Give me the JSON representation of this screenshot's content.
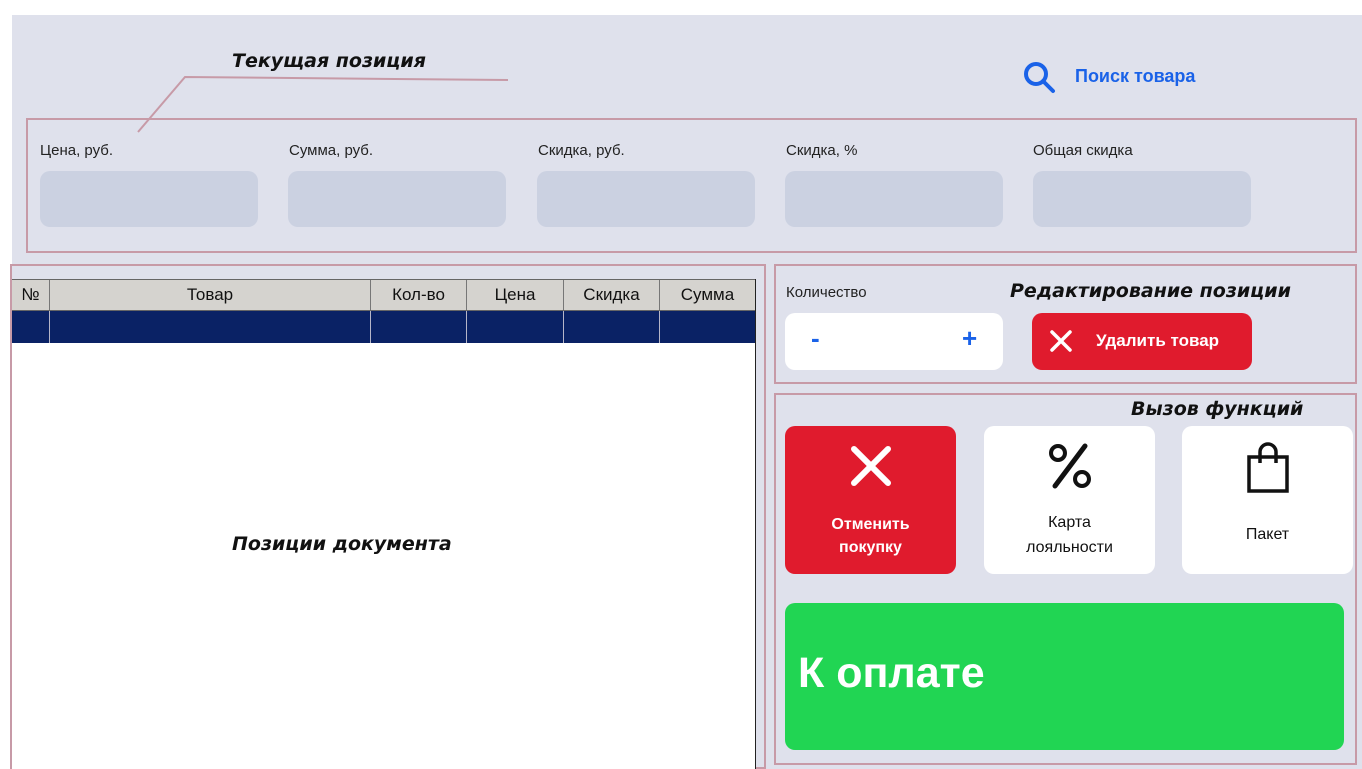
{
  "annotations": {
    "current_position": "Текущая позиция",
    "document_positions": "Позиции документа",
    "edit_position": "Редактирование позиции",
    "functions": "Вызов функций"
  },
  "search": {
    "label": "Поиск товара",
    "icon": "search-icon"
  },
  "fields": [
    {
      "label": "Цена, руб.",
      "value": ""
    },
    {
      "label": "Сумма, руб.",
      "value": ""
    },
    {
      "label": "Скидка, руб.",
      "value": ""
    },
    {
      "label": "Скидка, %",
      "value": ""
    },
    {
      "label": "Общая скидка",
      "value": ""
    }
  ],
  "table": {
    "columns": [
      "№",
      "Товар",
      "Кол-во",
      "Цена",
      "Скидка",
      "Сумма"
    ],
    "rows": []
  },
  "quantity": {
    "label": "Количество",
    "minus": "-",
    "plus": "+"
  },
  "delete_button": {
    "label": "Удалить товар",
    "icon": "close-icon"
  },
  "functions": {
    "cancel": {
      "label_line1": "Отменить",
      "label_line2": "покупку",
      "icon": "close-icon"
    },
    "loyalty": {
      "label_line1": "Карта",
      "label_line2": "лояльности",
      "icon": "percent-icon"
    },
    "bag": {
      "label": "Пакет",
      "icon": "shopping-bag-icon"
    }
  },
  "pay_button": {
    "label": "К оплате"
  },
  "colors": {
    "background": "#dfe1ec",
    "accent_blue": "#1a62e8",
    "danger_red": "#e01b2d",
    "pay_green": "#21d553",
    "selection_navy": "#0a2265"
  }
}
